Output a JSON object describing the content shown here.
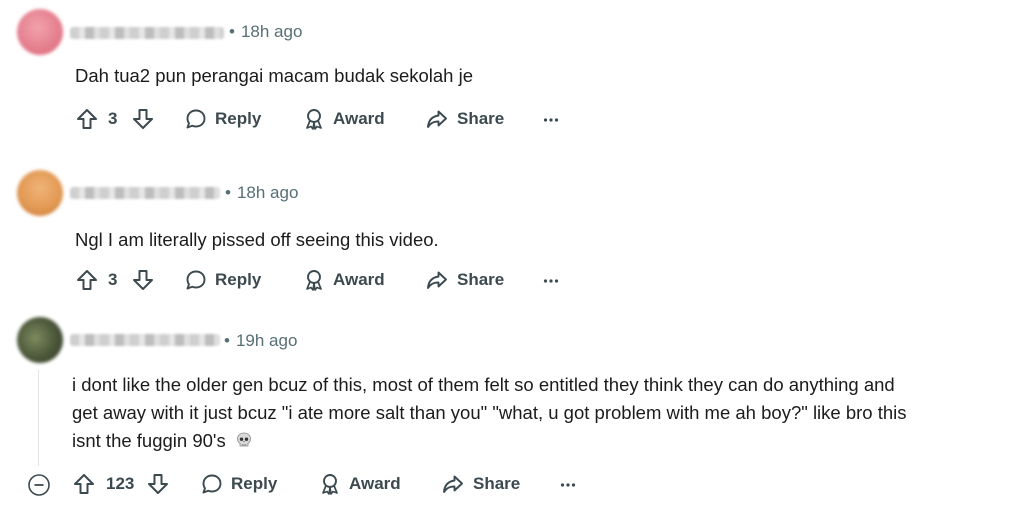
{
  "comments": [
    {
      "time": "18h ago",
      "text": "Dah tua2 pun perangai macam budak sekolah je",
      "votes": "3",
      "reply_label": "Reply",
      "award_label": "Award",
      "share_label": "Share"
    },
    {
      "time": "18h ago",
      "text": "Ngl I am literally pissed off seeing this video.",
      "votes": "3",
      "reply_label": "Reply",
      "award_label": "Award",
      "share_label": "Share"
    },
    {
      "time": "19h ago",
      "text_line1": "i dont like the older gen bcuz of this, most of them felt so entitled they think they can do anything and",
      "text_line2": "get away with it just bcuz \"i ate more salt than you\" \"what, u got problem with me ah boy?\" like bro this",
      "text_line3": "isnt the fuggin 90's",
      "votes": "123",
      "reply_label": "Reply",
      "award_label": "Award",
      "share_label": "Share"
    }
  ],
  "separator": "•",
  "colors": {
    "meta": "#576f76",
    "action": "#3c4a50",
    "avatar1": "#e5808f",
    "avatar2": "#e39a55",
    "avatar3": "#4f5a3c"
  }
}
